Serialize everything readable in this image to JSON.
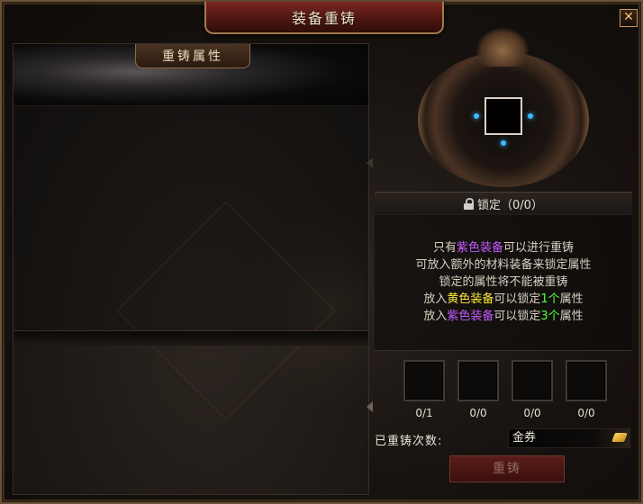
{
  "window": {
    "title": "装备重铸",
    "close_label": "✕"
  },
  "left_panel": {
    "title": "重铸属性"
  },
  "lock": {
    "label": "锁定（0/0）"
  },
  "info": {
    "line1": {
      "pre": "只有",
      "hl": "紫色装备",
      "post": "可以进行重铸"
    },
    "line2": "可放入额外的材料装备来锁定属性",
    "line3": "锁定的属性将不能被重铸",
    "line4": {
      "pre": "放入",
      "hl": "黄色装备",
      "mid": "可以锁定",
      "num": "1个",
      "post": "属性"
    },
    "line5": {
      "pre": "放入",
      "hl": "紫色装备",
      "mid": "可以锁定",
      "num": "3个",
      "post": "属性"
    }
  },
  "material_slots": [
    {
      "count": "0/1"
    },
    {
      "count": "0/0"
    },
    {
      "count": "0/0"
    },
    {
      "count": "0/0"
    }
  ],
  "recast_count": {
    "label": "已重铸次数:"
  },
  "currency": {
    "label": "金券"
  },
  "recast_button": {
    "label": "重铸"
  },
  "colors": {
    "purple_item": "#c45bff",
    "yellow_item": "#ffe83a",
    "lock_number": "#53ff46"
  }
}
